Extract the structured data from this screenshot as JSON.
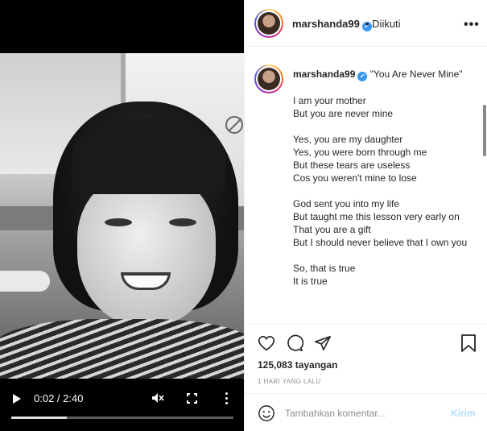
{
  "video": {
    "time": "0:02 / 2:40",
    "progress": 0.25
  },
  "header": {
    "username": "marshanda99",
    "verified_icon": "✔",
    "follow_status": "• Diikuti",
    "more_icon": "•••"
  },
  "caption": {
    "username": "marshanda99",
    "text": "\"You Are Never Mine\"\n\nI am your mother\nBut you are never mine\n\nYes, you are my daughter\nYes, you were born through me\nBut these tears are useless\nCos you weren't mine to lose\n\nGod sent you into my life\nBut taught me this lesson very early on\nThat you are a gift\nBut I should never believe that I own you\n\nSo, that is true\nIt is true"
  },
  "stats": {
    "views": "125,083 tayangan",
    "time_ago": "1 HARI YANG LALU"
  },
  "comment_box": {
    "placeholder": "Tambahkan komentar...",
    "post_label": "Kirim"
  }
}
